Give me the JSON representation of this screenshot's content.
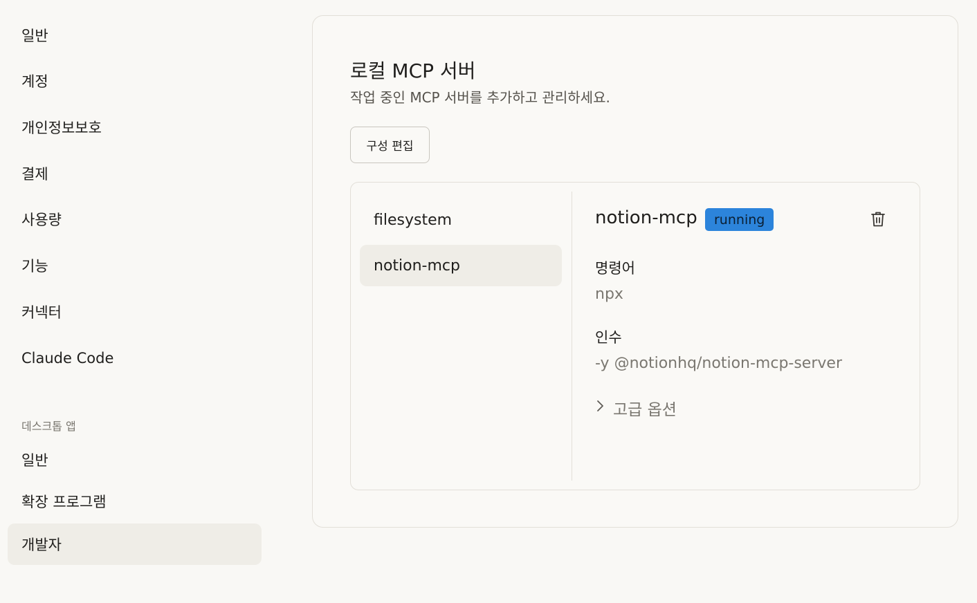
{
  "sidebar": {
    "items": [
      {
        "label": "일반"
      },
      {
        "label": "계정"
      },
      {
        "label": "개인정보보호"
      },
      {
        "label": "결제"
      },
      {
        "label": "사용량"
      },
      {
        "label": "기능"
      },
      {
        "label": "커넥터"
      },
      {
        "label": "Claude Code"
      }
    ],
    "desktop_section": "데스크톱 앱",
    "desktop_items": [
      {
        "label": "일반"
      },
      {
        "label": "확장 프로그램"
      },
      {
        "label": "개발자",
        "active": true
      }
    ]
  },
  "main": {
    "title": "로컬 MCP 서버",
    "subtitle": "작업 중인 MCP 서버를 추가하고 관리하세요.",
    "edit_button": "구성 편집",
    "servers": [
      {
        "name": "filesystem"
      },
      {
        "name": "notion-mcp",
        "active": true
      }
    ],
    "detail": {
      "name": "notion-mcp",
      "status": "running",
      "status_color": "#2c84db",
      "command_label": "명령어",
      "command_value": "npx",
      "args_label": "인수",
      "args_value": "-y @notionhq/notion-mcp-server",
      "advanced_label": "고급 옵션",
      "delete_icon": "trash-icon",
      "advanced_icon": "chevron-right-icon"
    }
  }
}
